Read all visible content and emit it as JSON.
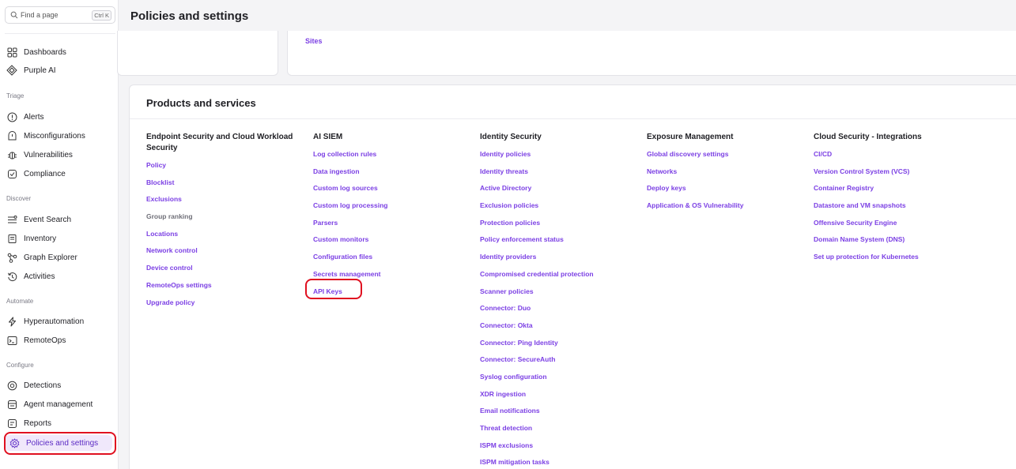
{
  "search": {
    "placeholder": "Find a page",
    "shortcut": "Ctrl K"
  },
  "sidebar": {
    "top_items": [
      {
        "label": "Dashboards",
        "icon": "dashboard-icon"
      },
      {
        "label": "Purple AI",
        "icon": "purple-ai-icon"
      }
    ],
    "sections": [
      {
        "label": "Triage",
        "items": [
          {
            "label": "Alerts",
            "icon": "alert-icon"
          },
          {
            "label": "Misconfigurations",
            "icon": "misconfig-icon"
          },
          {
            "label": "Vulnerabilities",
            "icon": "bug-icon"
          },
          {
            "label": "Compliance",
            "icon": "compliance-icon"
          }
        ]
      },
      {
        "label": "Discover",
        "items": [
          {
            "label": "Event Search",
            "icon": "event-search-icon"
          },
          {
            "label": "Inventory",
            "icon": "inventory-icon"
          },
          {
            "label": "Graph Explorer",
            "icon": "graph-icon"
          },
          {
            "label": "Activities",
            "icon": "history-icon"
          }
        ]
      },
      {
        "label": "Automate",
        "items": [
          {
            "label": "Hyperautomation",
            "icon": "lightning-icon"
          },
          {
            "label": "RemoteOps",
            "icon": "terminal-icon"
          }
        ]
      },
      {
        "label": "Configure",
        "items": [
          {
            "label": "Detections",
            "icon": "detections-icon"
          },
          {
            "label": "Agent management",
            "icon": "agent-icon"
          },
          {
            "label": "Reports",
            "icon": "reports-icon"
          },
          {
            "label": "Policies and settings",
            "icon": "gear-icon",
            "active": true
          }
        ]
      }
    ]
  },
  "header": {
    "title": "Policies and settings"
  },
  "sites_link": "Sites",
  "products": {
    "title": "Products and services",
    "columns": [
      {
        "title": "Endpoint Security and Cloud Workload Security",
        "links": [
          "Policy",
          "Blocklist",
          "Exclusions",
          "Group ranking",
          "Locations",
          "Network control",
          "Device control",
          "RemoteOps settings",
          "Upgrade policy"
        ]
      },
      {
        "title": "AI SIEM",
        "links": [
          "Log collection rules",
          "Data ingestion",
          "Custom log sources",
          "Custom log processing",
          "Parsers",
          "Custom monitors",
          "Configuration files",
          "Secrets management",
          "API Keys"
        ]
      },
      {
        "title": "Identity Security",
        "links": [
          "Identity policies",
          "Identity threats",
          "Active Directory",
          "Exclusion policies",
          "Protection policies",
          "Policy enforcement status",
          "Identity providers",
          "Compromised credential protection",
          "Scanner policies",
          "Connector: Duo",
          "Connector: Okta",
          "Connector: Ping Identity",
          "Connector: SecureAuth",
          "Syslog configuration",
          "XDR ingestion",
          "Email notifications",
          "Threat detection",
          "ISPM exclusions",
          "ISPM mitigation tasks"
        ]
      },
      {
        "title": "Exposure Management",
        "links": [
          "Global discovery settings",
          "Networks",
          "Deploy keys",
          "Application & OS Vulnerability"
        ]
      },
      {
        "title": "Cloud Security - Integrations",
        "links": [
          "CI/CD",
          "Version Control System (VCS)",
          "Container Registry",
          "Datastore and VM snapshots",
          "Offensive Security Engine",
          "Domain Name System (DNS)",
          "Set up protection for Kubernetes"
        ]
      }
    ]
  },
  "colors": {
    "accent": "#7b3fe4",
    "active_bg": "#f0e8fb",
    "highlight": "#e01020"
  }
}
